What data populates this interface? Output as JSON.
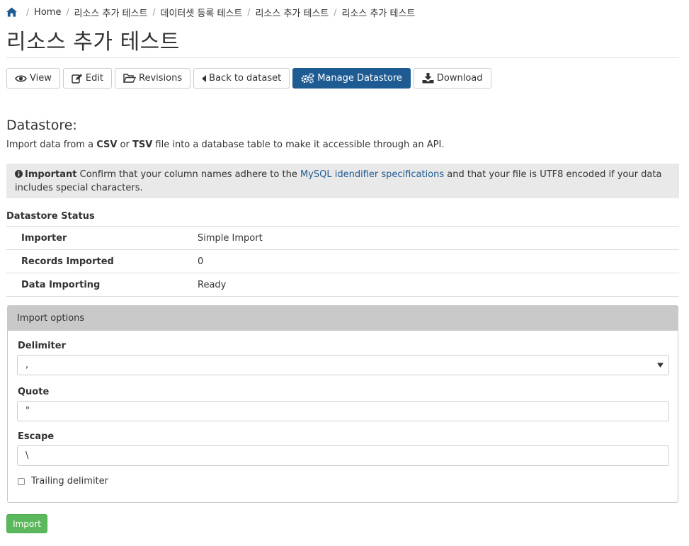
{
  "breadcrumb": {
    "items": [
      "Home",
      "리소스 추가 테스트",
      "데이터셋 등록 테스트",
      "리소스 추가 테스트",
      "리소스 추가 테스트"
    ],
    "separator": "/"
  },
  "page_title": "리소스 추가 테스트",
  "tabs": [
    {
      "label": "View",
      "icon": "eye-icon"
    },
    {
      "label": "Edit",
      "icon": "edit-icon"
    },
    {
      "label": "Revisions",
      "icon": "folder-open-icon"
    },
    {
      "label": "Back to dataset",
      "icon": "caret-left-icon"
    },
    {
      "label": "Manage Datastore",
      "icon": "cogs-icon",
      "active": true
    },
    {
      "label": "Download",
      "icon": "download-icon"
    }
  ],
  "datastore": {
    "heading": "Datastore:",
    "intro": {
      "prefix": "Import data from a ",
      "csv": "CSV",
      "or": " or ",
      "tsv": "TSV",
      "suffix": " file into a database table to make it accessible through an API."
    },
    "alert": {
      "strong": "Important",
      "before_link": " Confirm that your column names adhere to the ",
      "link": "MySQL idendifier specifications",
      "after_link": " and that your file is UTF8 encoded if your data includes special characters."
    },
    "status_title": "Datastore Status",
    "status_rows": [
      {
        "key": "Importer",
        "value": "Simple Import"
      },
      {
        "key": "Records Imported",
        "value": "0"
      },
      {
        "key": "Data Importing",
        "value": "Ready"
      }
    ]
  },
  "import_options": {
    "title": "Import options",
    "delimiter_label": "Delimiter",
    "delimiter_value": ",",
    "quote_label": "Quote",
    "quote_value": "\"",
    "escape_label": "Escape",
    "escape_value": "\\",
    "trailing_label": "Trailing delimiter",
    "submit_label": "Import"
  },
  "colors": {
    "primary": "#1f5b93",
    "success": "#5cb85c",
    "alert_bg": "#e9e9e9",
    "panel_head_bg": "#c9c9c9"
  }
}
